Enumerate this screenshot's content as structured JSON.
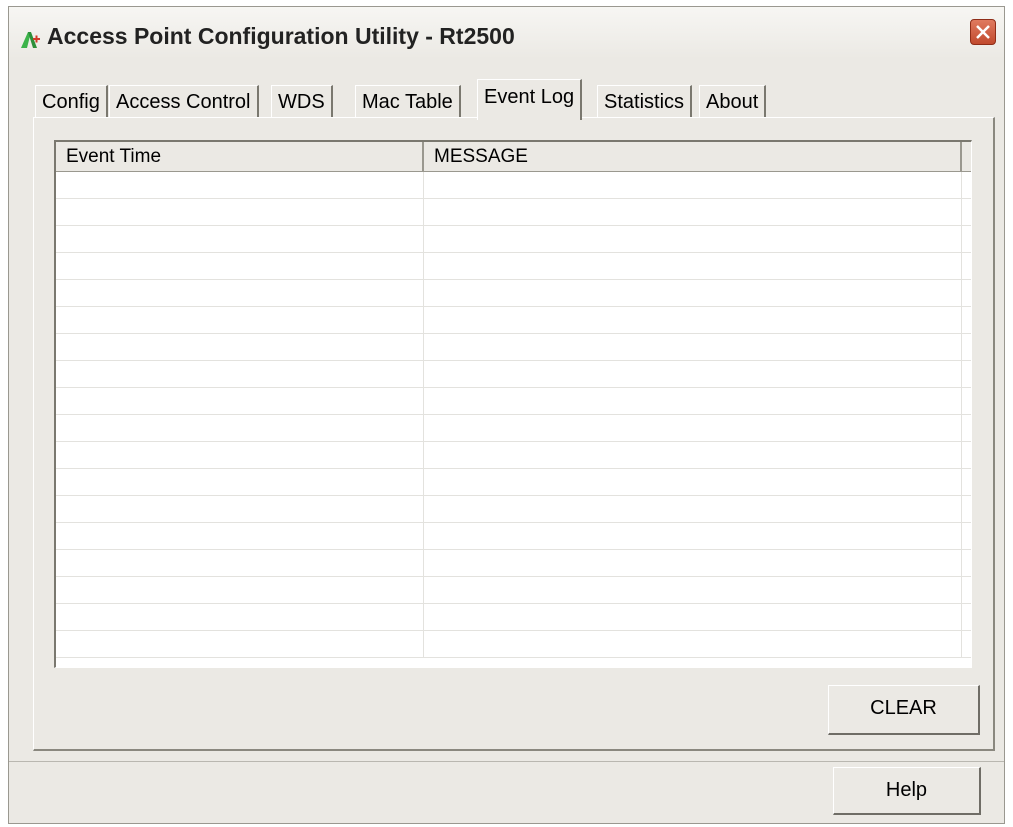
{
  "window": {
    "title": "Access Point Configuration Utility - Rt2500",
    "accent_color": "#d9563a",
    "icon": "app-logo-icon",
    "close_icon": "close-icon"
  },
  "tabs": [
    {
      "label": "Config",
      "active": false
    },
    {
      "label": "Access Control",
      "active": false
    },
    {
      "label": "WDS",
      "active": false
    },
    {
      "label": "Mac Table",
      "active": false
    },
    {
      "label": "Event Log",
      "active": true
    },
    {
      "label": "Statistics",
      "active": false
    },
    {
      "label": "About",
      "active": false
    }
  ],
  "event_log": {
    "columns": [
      "Event Time",
      "MESSAGE"
    ],
    "rows": []
  },
  "buttons": {
    "clear": "CLEAR",
    "help": "Help"
  }
}
